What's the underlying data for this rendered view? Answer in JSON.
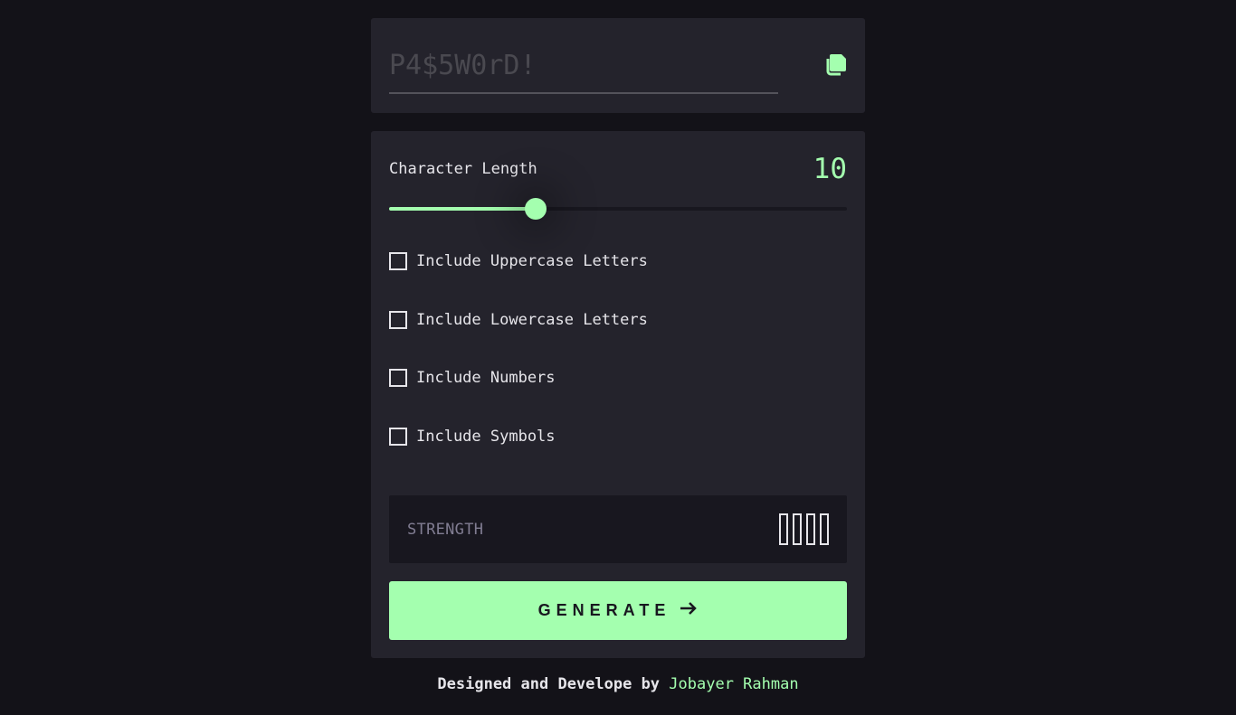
{
  "password": {
    "placeholder": "P4$5W0rD!",
    "value": ""
  },
  "copy": {
    "icon": "copy-icon"
  },
  "length": {
    "label": "Character Length",
    "value": "10",
    "slider_fraction": 0.32
  },
  "options": [
    {
      "label": "Include Uppercase Letters",
      "checked": false
    },
    {
      "label": "Include Lowercase Letters",
      "checked": false
    },
    {
      "label": "Include Numbers",
      "checked": false
    },
    {
      "label": "Include Symbols",
      "checked": false
    }
  ],
  "strength": {
    "label": "STRENGTH",
    "level": 0,
    "bars": 4
  },
  "generate": {
    "label": "GENERATE",
    "icon": "arrow-right-icon"
  },
  "footer": {
    "prefix": "Designed and Develope by",
    "author": "Jobayer Rahman"
  },
  "colors": {
    "accent": "#A4FFAF",
    "bg": "#131218",
    "panel": "#24232C",
    "dark": "#18171F"
  }
}
